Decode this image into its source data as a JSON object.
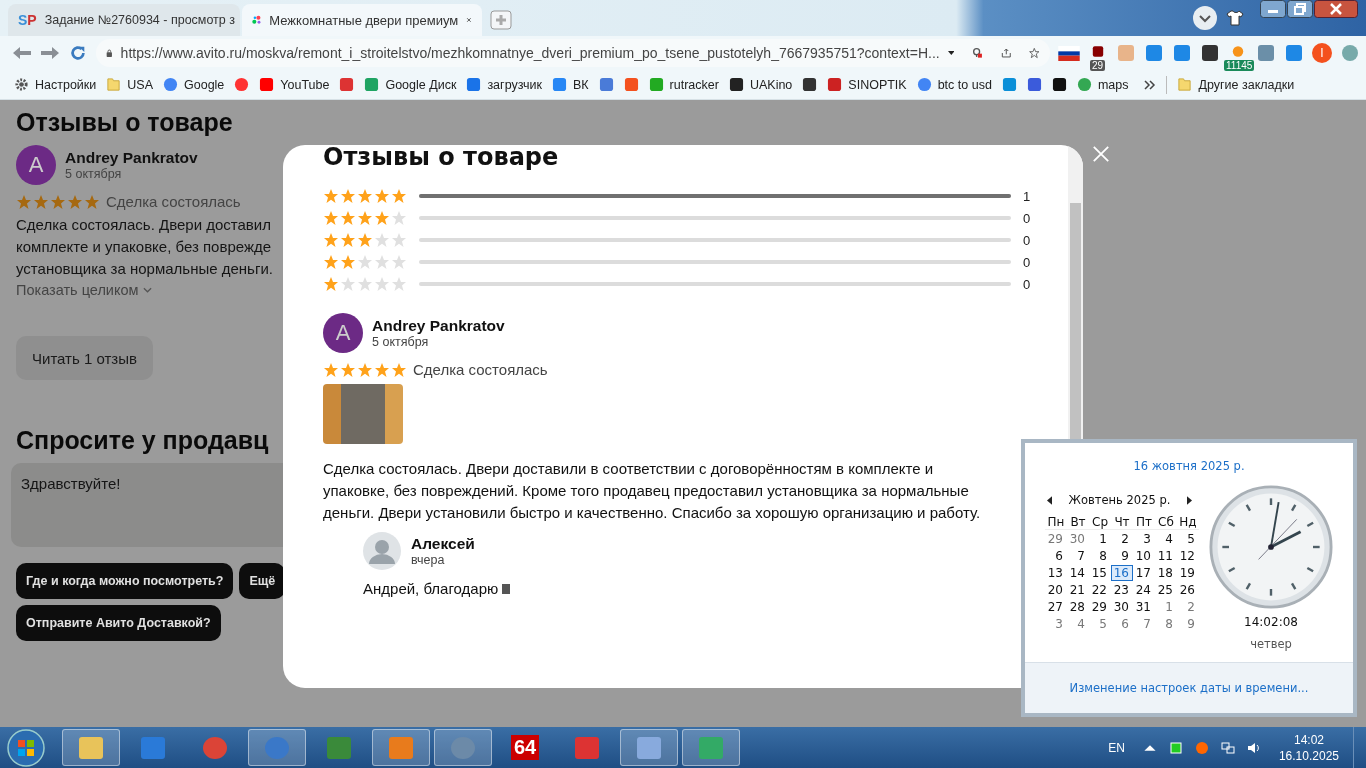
{
  "browser": {
    "tabs": [
      {
        "title": "Задание №2760934 - просмотр з",
        "favicon_text": "SP",
        "selected": false
      },
      {
        "title": "Межкомнатные двери премиум",
        "selected": true
      }
    ],
    "url": "https://www.avito.ru/moskva/remont_i_stroitelstvo/mezhkomnatnye_dveri_premium_po_tsene_pustotelyh_7667935751?context=H...",
    "extensions": [
      {
        "kind": "flag"
      },
      {
        "kind": "shield",
        "badge": "29"
      },
      {
        "kind": "face"
      },
      {
        "kind": "diamond"
      },
      {
        "kind": "download"
      },
      {
        "kind": "box"
      },
      {
        "kind": "coin",
        "badge": "11145"
      },
      {
        "kind": "puzzle"
      },
      {
        "kind": "arrow"
      },
      {
        "kind": "profile",
        "initial": "I"
      },
      {
        "kind": "globe"
      }
    ],
    "bookmarks": [
      {
        "kind": "link",
        "label": "Настройки"
      },
      {
        "kind": "link",
        "label": "USA"
      },
      {
        "kind": "link",
        "label": "Google"
      },
      {
        "kind": "icon"
      },
      {
        "kind": "link",
        "label": "YouTube"
      },
      {
        "kind": "icon"
      },
      {
        "kind": "link",
        "label": "Google Диск"
      },
      {
        "kind": "link",
        "label": "загрузчик"
      },
      {
        "kind": "link",
        "label": "ВК"
      },
      {
        "kind": "icon"
      },
      {
        "kind": "icon"
      },
      {
        "kind": "link",
        "label": "rutracker"
      },
      {
        "kind": "link",
        "label": "UAKino"
      },
      {
        "kind": "icon"
      },
      {
        "kind": "link",
        "label": "SINOPTIK"
      },
      {
        "kind": "link",
        "label": "btc to usd"
      },
      {
        "kind": "icon"
      },
      {
        "kind": "icon"
      },
      {
        "kind": "icon"
      },
      {
        "kind": "link",
        "label": "maps"
      }
    ],
    "other_bookmarks": "Другие закладки"
  },
  "page": {
    "heading": "Отзывы о товаре",
    "review": {
      "avatar": "A",
      "author": "Andrey Pankratov",
      "date": "5 октября",
      "stars": 5,
      "status": "Сделка состоялась",
      "lines": [
        "Сделка состоялась. Двери доставил",
        "комплекте и упаковке, без поврежде",
        "установщика за нормальные деньги."
      ],
      "expand": "Показать целиком"
    },
    "read_button": "Читать 1 отзыв",
    "ask_heading": "Спросите у продавц",
    "message": "Здравствуйте!",
    "chips": [
      "Где и когда можно посмотреть?",
      "Ещё",
      "Отправите Авито Доставкой?"
    ]
  },
  "modal": {
    "title": "Отзывы о товаре",
    "ratings": [
      {
        "stars": 5,
        "level": 1,
        "count": "1"
      },
      {
        "stars": 4,
        "level": 0,
        "count": "0"
      },
      {
        "stars": 3,
        "level": 0,
        "count": "0"
      },
      {
        "stars": 2,
        "level": 0,
        "count": "0"
      },
      {
        "stars": 1,
        "level": 0,
        "count": "0"
      }
    ],
    "review": {
      "avatar": "A",
      "author": "Andrey Pankratov",
      "date": "5 октября",
      "stars": 5,
      "status": "Сделка состоялась",
      "text": "Сделка состоялась. Двери доставили в соответствии с договорённостям в комплекте и упаковке, без повреждений. Кроме того продавец предоставил установщика за нормальные деньги. Двери установили быстро и качественно. Спасибо за хорошую организацию и работу.",
      "reply": {
        "author": "Алексей",
        "date": "вчера",
        "text": "Андрей, благодарю"
      }
    }
  },
  "calendar": {
    "date_link": "16 жовтня 2025 р.",
    "month": "Жовтень 2025 р.",
    "weekdays": [
      "Пн",
      "Вт",
      "Ср",
      "Чт",
      "Пт",
      "Сб",
      "Нд"
    ],
    "weeks": [
      [
        {
          "day": "29",
          "other_month": true,
          "selected": false
        },
        {
          "day": "30",
          "other_month": true,
          "selected": false
        },
        {
          "day": "1",
          "other_month": false,
          "selected": false
        },
        {
          "day": "2",
          "other_month": false,
          "selected": false
        },
        {
          "day": "3",
          "other_month": false,
          "selected": false
        },
        {
          "day": "4",
          "other_month": false,
          "selected": false
        },
        {
          "day": "5",
          "other_month": false,
          "selected": false
        }
      ],
      [
        {
          "day": "6",
          "other_month": false,
          "selected": false
        },
        {
          "day": "7",
          "other_month": false,
          "selected": false
        },
        {
          "day": "8",
          "other_month": false,
          "selected": false
        },
        {
          "day": "9",
          "other_month": false,
          "selected": false
        },
        {
          "day": "10",
          "other_month": false,
          "selected": false
        },
        {
          "day": "11",
          "other_month": false,
          "selected": false
        },
        {
          "day": "12",
          "other_month": false,
          "selected": false
        }
      ],
      [
        {
          "day": "13",
          "other_month": false,
          "selected": false
        },
        {
          "day": "14",
          "other_month": false,
          "selected": false
        },
        {
          "day": "15",
          "other_month": false,
          "selected": false
        },
        {
          "day": "16",
          "other_month": false,
          "selected": true
        },
        {
          "day": "17",
          "other_month": false,
          "selected": false
        },
        {
          "day": "18",
          "other_month": false,
          "selected": false
        },
        {
          "day": "19",
          "other_month": false,
          "selected": false
        }
      ],
      [
        {
          "day": "20",
          "other_month": false,
          "selected": false
        },
        {
          "day": "21",
          "other_month": false,
          "selected": false
        },
        {
          "day": "22",
          "other_month": false,
          "selected": false
        },
        {
          "day": "23",
          "other_month": false,
          "selected": false
        },
        {
          "day": "24",
          "other_month": false,
          "selected": false
        },
        {
          "day": "25",
          "other_month": false,
          "selected": false
        },
        {
          "day": "26",
          "other_month": false,
          "selected": false
        }
      ],
      [
        {
          "day": "27",
          "other_month": false,
          "selected": false
        },
        {
          "day": "28",
          "other_month": false,
          "selected": false
        },
        {
          "day": "29",
          "other_month": false,
          "selected": false
        },
        {
          "day": "30",
          "other_month": false,
          "selected": false
        },
        {
          "day": "31",
          "other_month": false,
          "selected": false
        },
        {
          "day": "1",
          "other_month": true,
          "selected": false
        },
        {
          "day": "2",
          "other_month": true,
          "selected": false
        }
      ],
      [
        {
          "day": "3",
          "other_month": true,
          "selected": false
        },
        {
          "day": "4",
          "other_month": true,
          "selected": false
        },
        {
          "day": "5",
          "other_month": true,
          "selected": false
        },
        {
          "day": "6",
          "other_month": true,
          "selected": false
        },
        {
          "day": "7",
          "other_month": true,
          "selected": false
        },
        {
          "day": "8",
          "other_month": true,
          "selected": false
        },
        {
          "day": "9",
          "other_month": true,
          "selected": false
        }
      ]
    ],
    "time": "14:02:08",
    "weekday": "четвер",
    "settings_link": "Изменение настроек даты и времени..."
  },
  "taskbar": {
    "apps": [
      {
        "running": true
      },
      {
        "running": false
      },
      {
        "running": false
      },
      {
        "running": true
      },
      {
        "running": false
      },
      {
        "running": true
      },
      {
        "running": true
      },
      {
        "running": false,
        "label": "64"
      },
      {
        "running": false
      },
      {
        "running": true
      },
      {
        "running": true
      }
    ],
    "language": "EN",
    "time": "14:02",
    "date": "16.10.2025"
  }
}
